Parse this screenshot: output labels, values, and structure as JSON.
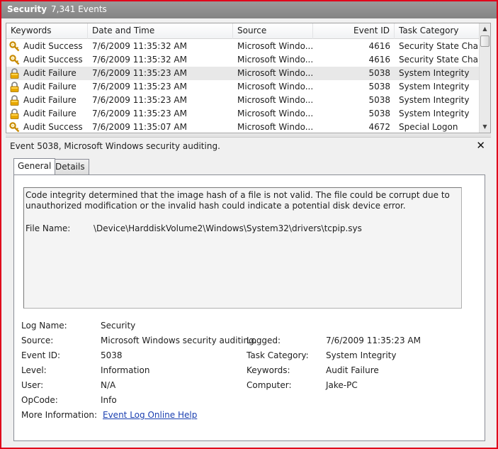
{
  "window": {
    "title": "Security",
    "event_count": "7,341 Events"
  },
  "table": {
    "columns": [
      {
        "label": "Keywords"
      },
      {
        "label": "Date and Time"
      },
      {
        "label": "Source"
      },
      {
        "label": "Event ID"
      },
      {
        "label": "Task Category"
      }
    ],
    "rows": [
      {
        "icon": "key-icon",
        "keywords": "Audit Success",
        "datetime": "7/6/2009 11:35:32 AM",
        "source": "Microsoft Windo...",
        "event_id": "4616",
        "task": "Security State Cha..."
      },
      {
        "icon": "key-icon",
        "keywords": "Audit Success",
        "datetime": "7/6/2009 11:35:32 AM",
        "source": "Microsoft Windo...",
        "event_id": "4616",
        "task": "Security State Cha..."
      },
      {
        "icon": "lock-icon",
        "keywords": "Audit Failure",
        "datetime": "7/6/2009 11:35:23 AM",
        "source": "Microsoft Windo...",
        "event_id": "5038",
        "task": "System Integrity",
        "selected": true
      },
      {
        "icon": "lock-icon",
        "keywords": "Audit Failure",
        "datetime": "7/6/2009 11:35:23 AM",
        "source": "Microsoft Windo...",
        "event_id": "5038",
        "task": "System Integrity"
      },
      {
        "icon": "lock-icon",
        "keywords": "Audit Failure",
        "datetime": "7/6/2009 11:35:23 AM",
        "source": "Microsoft Windo...",
        "event_id": "5038",
        "task": "System Integrity"
      },
      {
        "icon": "lock-icon",
        "keywords": "Audit Failure",
        "datetime": "7/6/2009 11:35:23 AM",
        "source": "Microsoft Windo...",
        "event_id": "5038",
        "task": "System Integrity"
      },
      {
        "icon": "key-icon",
        "keywords": "Audit Success",
        "datetime": "7/6/2009 11:35:07 AM",
        "source": "Microsoft Windo...",
        "event_id": "4672",
        "task": "Special Logon"
      }
    ]
  },
  "detail": {
    "title": "Event 5038, Microsoft Windows security auditing.",
    "close_glyph": "✕",
    "tabs": {
      "general": "General",
      "details": "Details"
    },
    "message": "Code integrity determined that the image hash of a file is not valid.  The file could be corrupt due to unauthorized modification or the invalid hash could indicate a potential disk device error.",
    "file_name_label": "File Name:",
    "file_name_value": "\\Device\\HarddiskVolume2\\Windows\\System32\\drivers\\tcpip.sys",
    "fields": {
      "log_name_label": "Log Name:",
      "log_name": "Security",
      "source_label": "Source:",
      "source": "Microsoft Windows security auditing.",
      "logged_label": "Logged:",
      "logged": "7/6/2009 11:35:23 AM",
      "event_id_label": "Event ID:",
      "event_id": "5038",
      "task_category_label": "Task Category:",
      "task_category": "System Integrity",
      "level_label": "Level:",
      "level": "Information",
      "keywords_label": "Keywords:",
      "keywords": "Audit Failure",
      "user_label": "User:",
      "user": "N/A",
      "computer_label": "Computer:",
      "computer": "Jake-PC",
      "opcode_label": "OpCode:",
      "opcode": "Info",
      "more_info_label": "More Information:",
      "more_info_link": "Event Log Online Help"
    }
  },
  "colors": {
    "frame_border": "#e0001a",
    "titlebar": "#8e8e8e",
    "link": "#1a3fb0",
    "selected_row": "#e8e8e8"
  }
}
